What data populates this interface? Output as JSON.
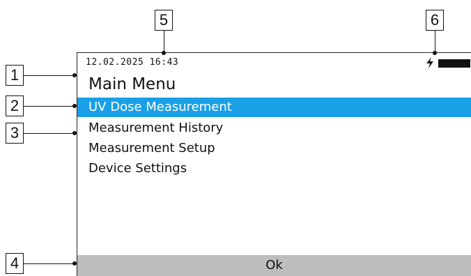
{
  "status": {
    "datetime": "12.02.2025 16:43",
    "charge_icon": "charging-bolt-icon",
    "battery_icon": "battery-full-icon"
  },
  "screen": {
    "title": "Main Menu",
    "menu_items": [
      {
        "label": "UV Dose Measurement",
        "selected": true
      },
      {
        "label": "Measurement History",
        "selected": false
      },
      {
        "label": "Measurement Setup",
        "selected": false
      },
      {
        "label": "Device Settings",
        "selected": false
      }
    ],
    "softkey": "Ok"
  },
  "colors": {
    "selection": "#1aa0e6",
    "softkey_bar": "#bdbdbd"
  },
  "callouts": [
    "1",
    "2",
    "3",
    "4",
    "5",
    "6"
  ]
}
